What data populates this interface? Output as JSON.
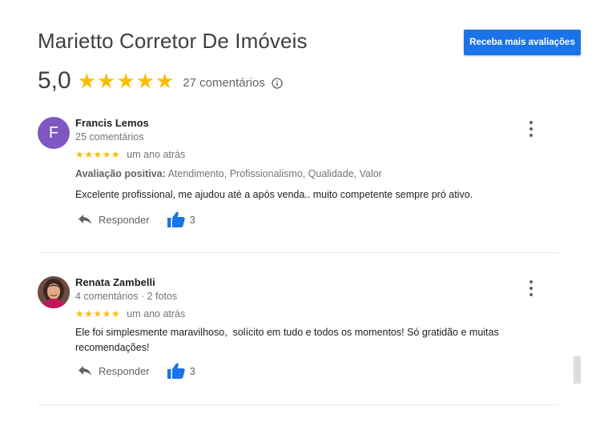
{
  "header": {
    "title": "Marietto Corretor De Imóveis",
    "cta_label": "Receba mais avaliações"
  },
  "summary": {
    "score": "5,0",
    "stars": "★★★★★",
    "count": "27 comentários"
  },
  "reviews": [
    {
      "avatar_letter": "F",
      "name": "Francis Lemos",
      "meta": "25 comentários",
      "stars": "★★★★★",
      "time": "um ano atrás",
      "positive_label": "Avaliação positiva:",
      "positive_values": "Atendimento, Profissionalismo, Qualidade, Valor",
      "text": "Excelente profissional, me ajudou até a após venda.. muito competente sempre pró ativo.",
      "reply_label": "Responder",
      "likes": "3"
    },
    {
      "name": "Renata Zambelli",
      "meta": "4 comentários · 2 fotos",
      "stars": "★★★★★",
      "time": "um ano atrás",
      "text": "Ele foi simplesmente maravilhoso,  solícito em tudo e todos os momentos! Só gratidão e muitas recomendações!",
      "reply_label": "Responder",
      "likes": "3"
    }
  ],
  "colors": {
    "accent": "#1a73e8",
    "star": "#fbbc04",
    "avatar_f": "#7e57c2"
  }
}
